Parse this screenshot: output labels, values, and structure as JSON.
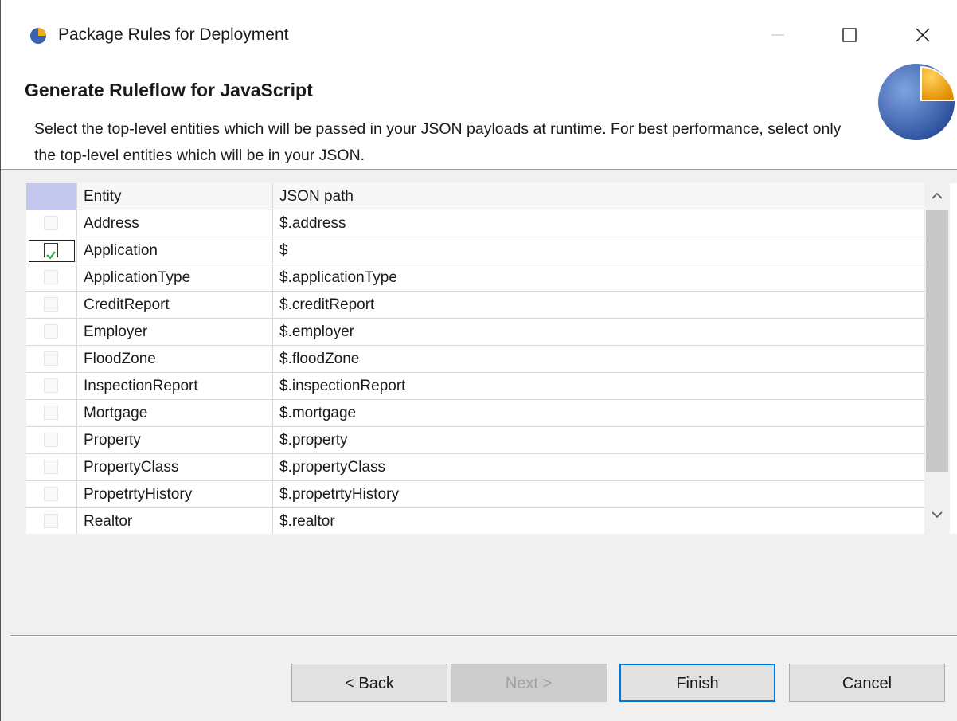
{
  "window": {
    "title": "Package Rules for Deployment",
    "controls": {
      "minimize": "—",
      "maximize": "☐",
      "close": "✕"
    }
  },
  "header": {
    "title": "Generate Ruleflow for JavaScript",
    "description": "Select the top-level entities which will be passed in your JSON payloads at runtime.  For best performance, select only the top-level entities which will be in your JSON."
  },
  "table": {
    "columns": [
      "Entity",
      "JSON path"
    ],
    "rows": [
      {
        "entity": "Address",
        "path": "$.address",
        "checked": false
      },
      {
        "entity": "Application",
        "path": "$",
        "checked": true
      },
      {
        "entity": "ApplicationType",
        "path": "$.applicationType",
        "checked": false
      },
      {
        "entity": "CreditReport",
        "path": "$.creditReport",
        "checked": false
      },
      {
        "entity": "Employer",
        "path": "$.employer",
        "checked": false
      },
      {
        "entity": "FloodZone",
        "path": "$.floodZone",
        "checked": false
      },
      {
        "entity": "InspectionReport",
        "path": "$.inspectionReport",
        "checked": false
      },
      {
        "entity": "Mortgage",
        "path": "$.mortgage",
        "checked": false
      },
      {
        "entity": "Property",
        "path": "$.property",
        "checked": false
      },
      {
        "entity": "PropertyClass",
        "path": "$.propertyClass",
        "checked": false
      },
      {
        "entity": "PropetrtyHistory",
        "path": "$.propetrtyHistory",
        "checked": false
      },
      {
        "entity": "Realtor",
        "path": "$.realtor",
        "checked": false
      }
    ]
  },
  "buttons": {
    "back": "< Back",
    "next": "Next >",
    "finish": "Finish",
    "cancel": "Cancel"
  },
  "colors": {
    "accent": "#0078d7",
    "header_check_bg": "#c5c8ee",
    "check_mark": "#2e9e3e"
  },
  "icons": [
    "app-logo-icon",
    "wizard-logo-icon",
    "minimize-icon",
    "maximize-icon",
    "close-icon",
    "scroll-up-icon",
    "scroll-down-icon",
    "checkmark-icon"
  ]
}
